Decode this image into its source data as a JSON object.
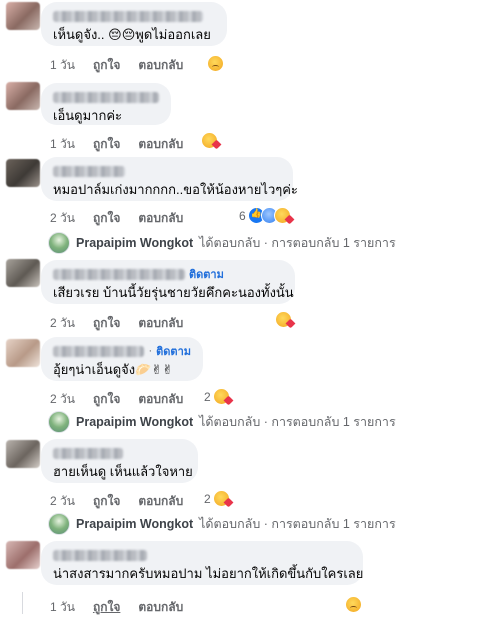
{
  "actions": {
    "like": "ถูกใจ",
    "reply": "ตอบกลับ"
  },
  "follow_label": "ติดตาม",
  "comments": [
    {
      "text": "เห็นดูจัง.. 😔😔พูดไม่ออกเลย",
      "time": "1 วัน"
    },
    {
      "text": "เอ็นดูมากค่ะ",
      "time": "1 วัน"
    },
    {
      "text": "หมอปาล์มเก่งมากกกก..ขอให้น้องหายไวๆค่ะ",
      "time": "2 วัน",
      "reaction_count": "6"
    },
    {
      "text": "เสียวเรย บ้านนี้วัยรุ่นชายวัยคึกคะนองทั้งนั้น",
      "time": "2 วัน"
    },
    {
      "text": "อุ้ยๆน่าเอ็นดูจัง🥟✌✌",
      "time": "2 วัน",
      "reaction_count": "2"
    },
    {
      "text": "ฮายเห็นดู เห็นแล้วใจหาย",
      "time": "2 วัน",
      "reaction_count": "2"
    },
    {
      "text": "น่าสงสารมากครับหมอปาม ไม่อยากให้เกิดขึ้นกับใครเลย",
      "time": "1 วัน"
    }
  ],
  "replies": {
    "name": "Prapaipim Wongkot",
    "rest": "ได้ตอบกลับ · การตอบกลับ 1 รายการ"
  },
  "icons": {
    "reaction_sad": "sad-face-icon",
    "reaction_care": "care-heart-icon",
    "reaction_like": "like-thumb-icon"
  },
  "colors": {
    "bubble": "#f0f2f5",
    "follow": "#216fdb",
    "meta": "#65676b"
  }
}
